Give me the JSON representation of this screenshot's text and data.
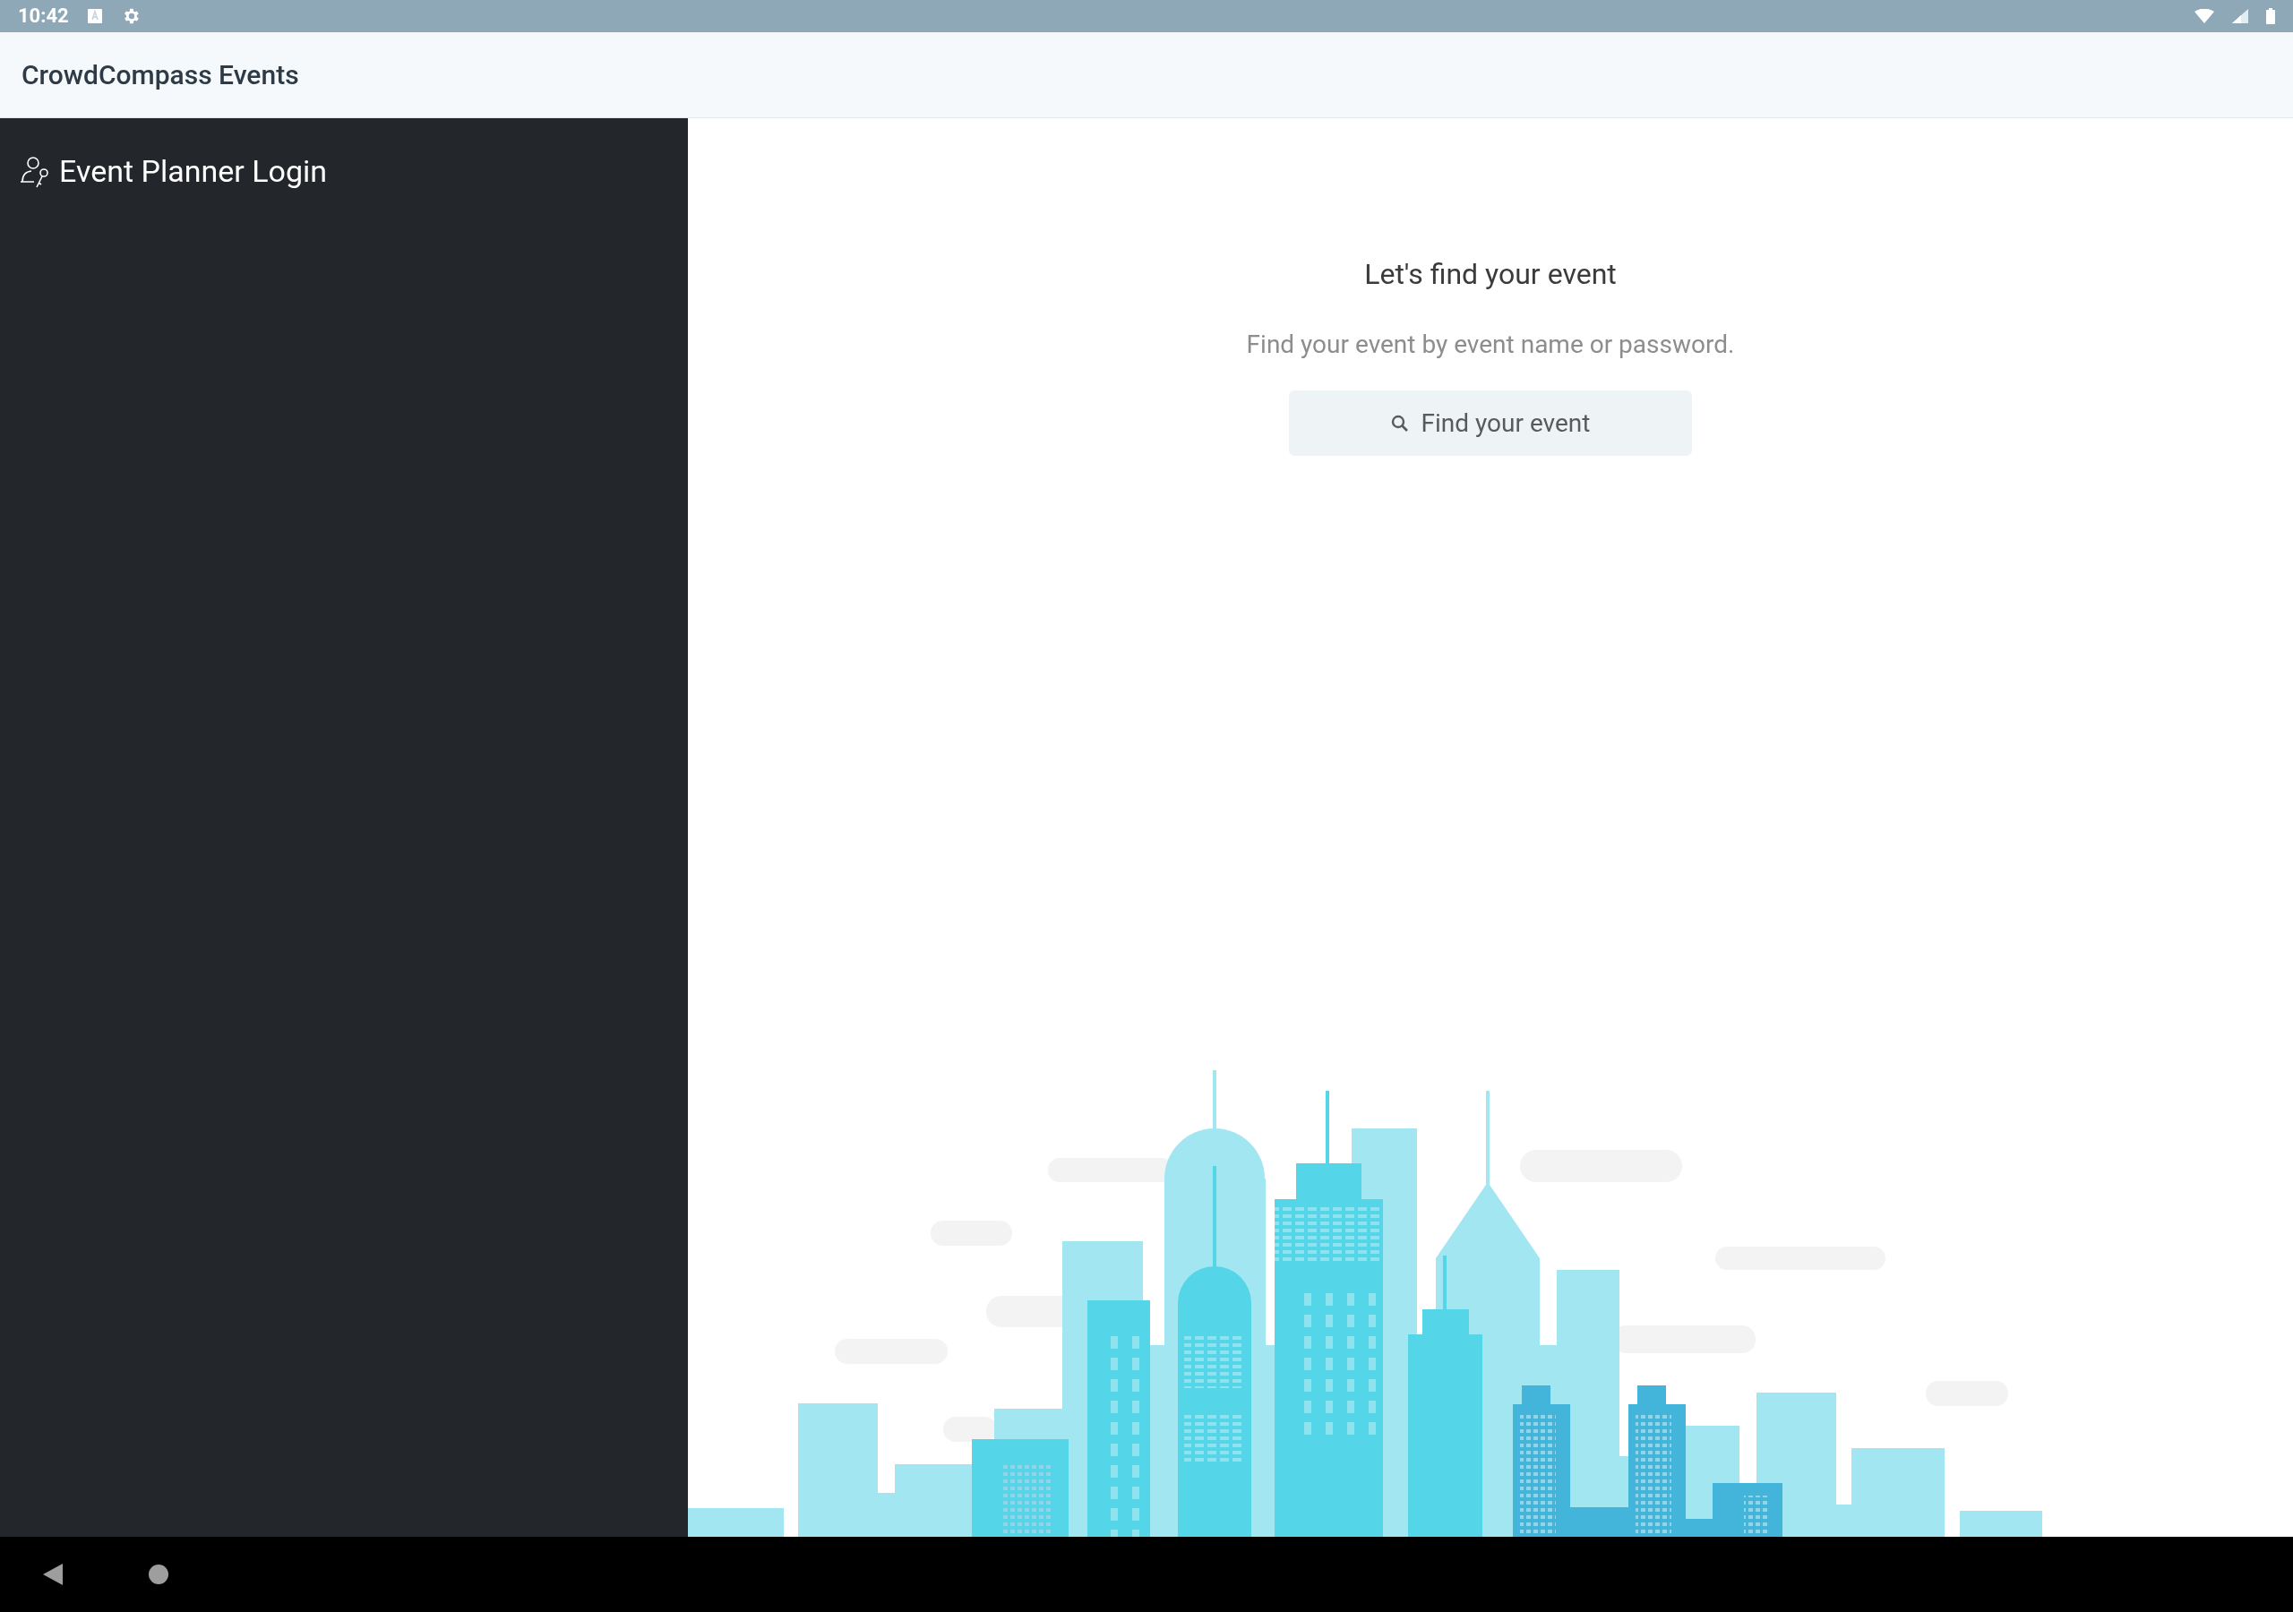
{
  "status_bar": {
    "time": "10:42"
  },
  "app_bar": {
    "title": "CrowdCompass Events"
  },
  "sidebar": {
    "items": [
      {
        "label": "Event Planner Login"
      }
    ]
  },
  "main": {
    "heading": "Let's find your event",
    "subtitle": "Find your event by event name or password.",
    "search_button": {
      "label": "Find your event"
    }
  }
}
